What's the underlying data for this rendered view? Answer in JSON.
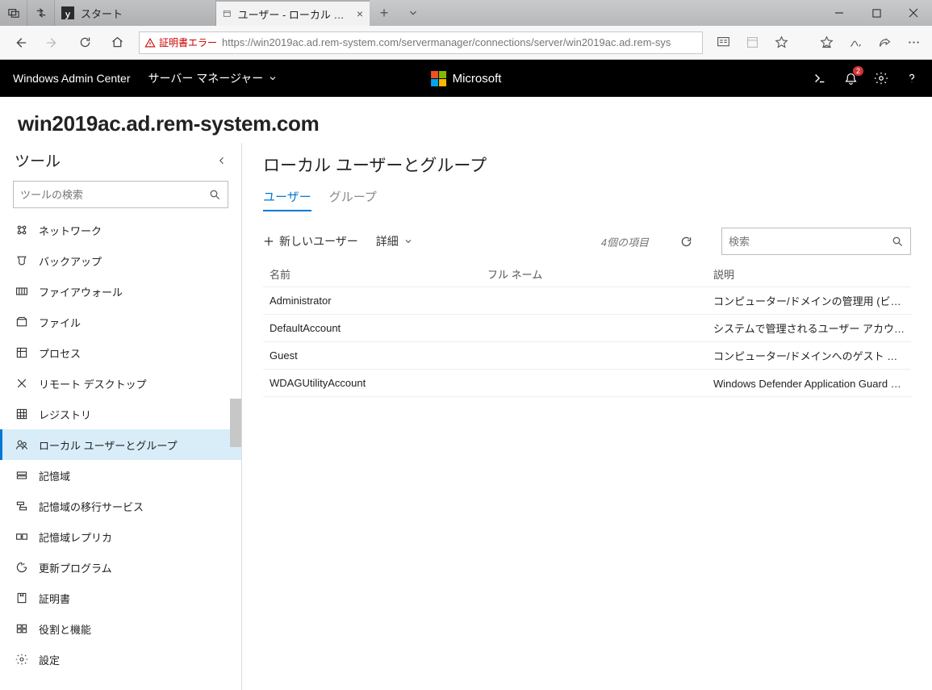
{
  "titlebar": {
    "start_tab_label": "スタート",
    "active_tab_label": "ユーザー - ローカル ユーザーと"
  },
  "addrbar": {
    "cert_error": "証明書エラー",
    "url": "https://win2019ac.ad.rem-system.com/servermanager/connections/server/win2019ac.ad.rem-sys"
  },
  "wac": {
    "brand": "Windows Admin Center",
    "context": "サーバー マネージャー",
    "ms": "Microsoft",
    "notif_count": "2"
  },
  "page_title": "win2019ac.ad.rem-system.com",
  "sidebar": {
    "title": "ツール",
    "search_placeholder": "ツールの検索",
    "items": [
      {
        "label": "ネットワーク"
      },
      {
        "label": "バックアップ"
      },
      {
        "label": "ファイアウォール"
      },
      {
        "label": "ファイル"
      },
      {
        "label": "プロセス"
      },
      {
        "label": "リモート デスクトップ"
      },
      {
        "label": "レジストリ"
      },
      {
        "label": "ローカル ユーザーとグループ",
        "selected": true
      },
      {
        "label": "記憶域"
      },
      {
        "label": "記憶域の移行サービス"
      },
      {
        "label": "記憶域レプリカ"
      },
      {
        "label": "更新プログラム"
      },
      {
        "label": "証明書"
      },
      {
        "label": "役割と機能"
      },
      {
        "label": "設定"
      }
    ]
  },
  "main": {
    "heading": "ローカル ユーザーとグループ",
    "tabs": {
      "users": "ユーザー",
      "groups": "グループ"
    },
    "cmd_new": "新しいユーザー",
    "cmd_detail": "詳細",
    "count_label": "4個の項目",
    "search_placeholder": "検索",
    "cols": {
      "name": "名前",
      "full": "フル ネーム",
      "desc": "説明"
    },
    "rows": [
      {
        "name": "Administrator",
        "full": "",
        "desc": "コンピューター/ドメインの管理用 (ビルト..."
      },
      {
        "name": "DefaultAccount",
        "full": "",
        "desc": "システムで管理されるユーザー アカウント..."
      },
      {
        "name": "Guest",
        "full": "",
        "desc": "コンピューター/ドメインへのゲスト アク..."
      },
      {
        "name": "WDAGUtilityAccount",
        "full": "",
        "desc": "Windows Defender Application Guard シナ..."
      }
    ]
  }
}
